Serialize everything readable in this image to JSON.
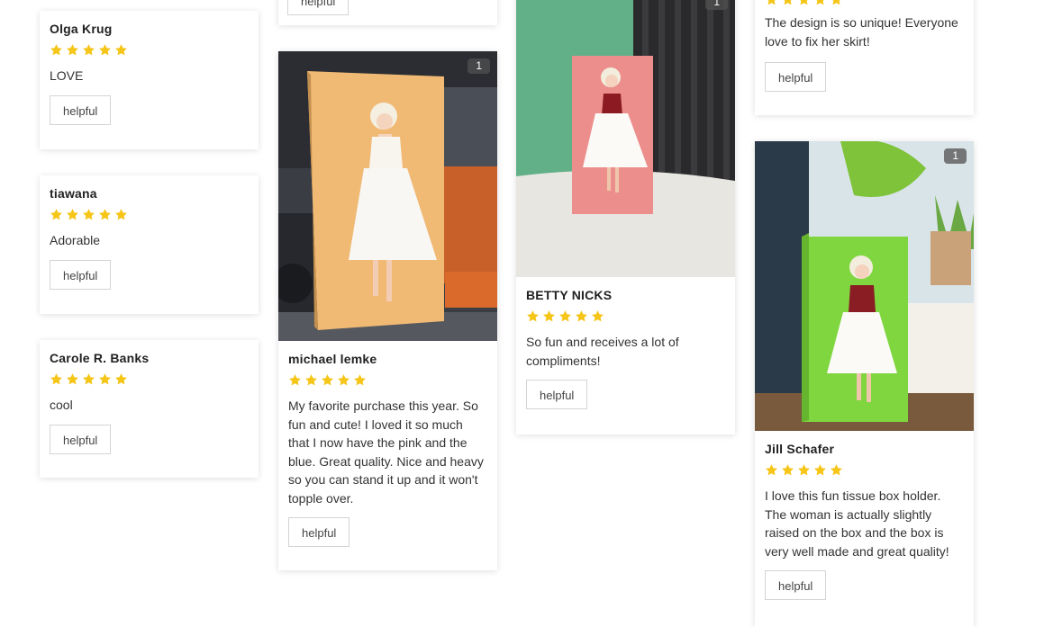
{
  "helpful_label": "helpful",
  "star_color": "#f5c518",
  "reviews": [
    {
      "author": "Olga Krug",
      "rating": 5,
      "text": "LOVE"
    },
    {
      "author": "tiawana",
      "rating": 5,
      "text": "Adorable"
    },
    {
      "author": "Carole R. Banks",
      "rating": 5,
      "text": "cool"
    },
    {
      "author": "michael lemke",
      "rating": 5,
      "text": "My favorite purchase this year. So fun and cute! I loved it so much that I now have the pink and the blue. Great quality. Nice and heavy so you can stand it up and it won't topple over.",
      "image_count": "1"
    },
    {
      "author": "BETTY NICKS",
      "rating": 5,
      "text": "So fun and receives a lot of compliments!",
      "image_count": "1"
    },
    {
      "rating": 5,
      "text": "The design is so unique! Everyone love to fix her skirt!"
    },
    {
      "author": "Jill Schafer",
      "rating": 5,
      "text": "I love this fun tissue box holder. The woman is actually slightly raised on the box and the box is very well made and great quality!",
      "image_count": "1"
    }
  ]
}
